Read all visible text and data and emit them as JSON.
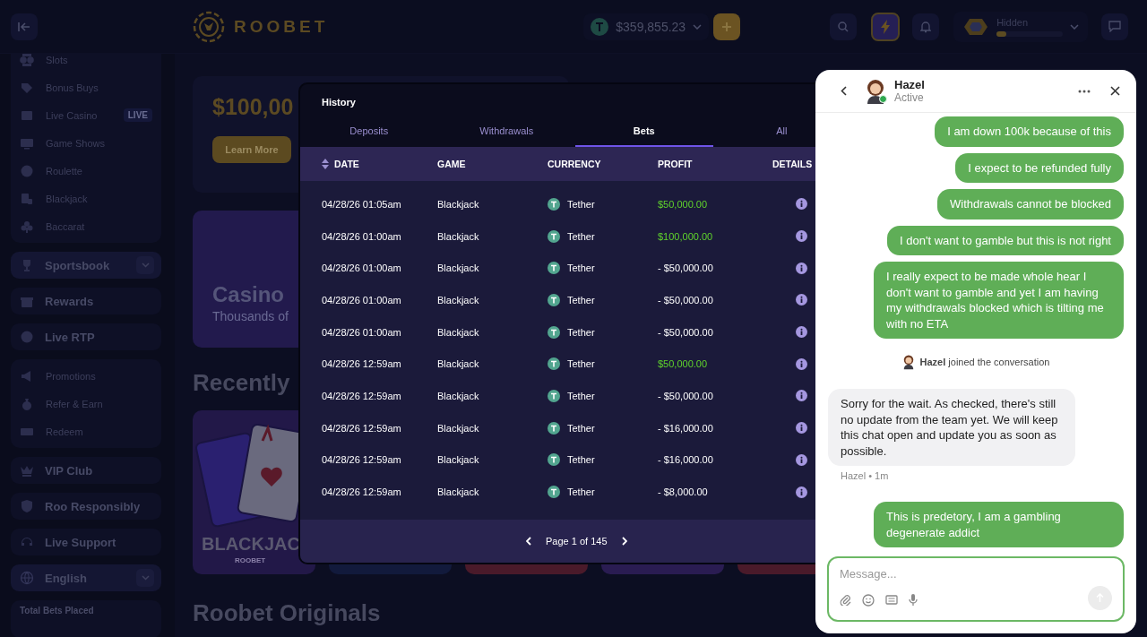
{
  "header": {
    "logo_text": "ROOBET",
    "balance": "$359,855.23",
    "profile": {
      "name": "Hidden",
      "level": 0.15
    }
  },
  "sidebar": {
    "sections": [
      {
        "kind": "group",
        "items": [
          {
            "label": "Slots"
          },
          {
            "label": "Bonus Buys"
          },
          {
            "label": "Live Casino",
            "badge": "LIVE"
          },
          {
            "label": "Game Shows"
          },
          {
            "label": "Roulette"
          },
          {
            "label": "Blackjack"
          },
          {
            "label": "Baccarat"
          }
        ]
      },
      {
        "kind": "single",
        "label": "Sportsbook",
        "dropdown": true
      },
      {
        "kind": "single",
        "label": "Rewards",
        "dropdown": false
      },
      {
        "kind": "single",
        "label": "Live RTP",
        "dropdown": false
      },
      {
        "kind": "group",
        "items": [
          {
            "label": "Promotions"
          },
          {
            "label": "Refer & Earn"
          },
          {
            "label": "Redeem"
          }
        ]
      },
      {
        "kind": "single",
        "label": "VIP Club",
        "dropdown": false
      },
      {
        "kind": "single",
        "label": "Roo Responsibly",
        "dropdown": false
      },
      {
        "kind": "single",
        "label": "Live Support",
        "dropdown": false
      },
      {
        "kind": "single",
        "label": "English",
        "dropdown": true
      }
    ],
    "footer": "Total Bets Placed"
  },
  "main": {
    "promo": {
      "amount": "$100,00",
      "button": "Learn More"
    },
    "casino_card": {
      "title": "Casino",
      "subtitle": "Thousands of"
    },
    "recent_heading": "Recently",
    "game_card": {
      "title": "BLACKJAC",
      "brand": "ROOBET"
    },
    "originals_heading": "Roobet Originals"
  },
  "history": {
    "title": "History",
    "tabs": [
      {
        "label": "Deposits",
        "selected": false
      },
      {
        "label": "Withdrawals",
        "selected": false
      },
      {
        "label": "Bets",
        "selected": true
      },
      {
        "label": "All",
        "selected": false
      }
    ],
    "columns": [
      "DATE",
      "GAME",
      "CURRENCY",
      "PROFIT",
      "DETAILS"
    ],
    "rows": [
      {
        "date": "04/28/26 01:05am",
        "game": "Blackjack",
        "currency": "Tether",
        "profit": "$50,000.00",
        "kind": "win"
      },
      {
        "date": "04/28/26 01:00am",
        "game": "Blackjack",
        "currency": "Tether",
        "profit": "$100,000.00",
        "kind": "win"
      },
      {
        "date": "04/28/26 01:00am",
        "game": "Blackjack",
        "currency": "Tether",
        "profit": "- $50,000.00",
        "kind": "loss"
      },
      {
        "date": "04/28/26 01:00am",
        "game": "Blackjack",
        "currency": "Tether",
        "profit": "- $50,000.00",
        "kind": "loss"
      },
      {
        "date": "04/28/26 01:00am",
        "game": "Blackjack",
        "currency": "Tether",
        "profit": "- $50,000.00",
        "kind": "loss"
      },
      {
        "date": "04/28/26 12:59am",
        "game": "Blackjack",
        "currency": "Tether",
        "profit": "$50,000.00",
        "kind": "win"
      },
      {
        "date": "04/28/26 12:59am",
        "game": "Blackjack",
        "currency": "Tether",
        "profit": "- $50,000.00",
        "kind": "loss"
      },
      {
        "date": "04/28/26 12:59am",
        "game": "Blackjack",
        "currency": "Tether",
        "profit": "- $16,000.00",
        "kind": "loss"
      },
      {
        "date": "04/28/26 12:59am",
        "game": "Blackjack",
        "currency": "Tether",
        "profit": "- $16,000.00",
        "kind": "loss"
      },
      {
        "date": "04/28/26 12:59am",
        "game": "Blackjack",
        "currency": "Tether",
        "profit": "- $8,000.00",
        "kind": "loss"
      }
    ],
    "pagination": "Page 1 of 145"
  },
  "chat": {
    "agent": {
      "name": "Hazel",
      "status": "Active",
      "online": true
    },
    "messages": [
      {
        "kind": "user",
        "text": "I am down 100k because of this"
      },
      {
        "kind": "user",
        "text": "I expect to be refunded fully"
      },
      {
        "kind": "user",
        "text": "Withdrawals cannot be blocked"
      },
      {
        "kind": "user",
        "text": "I don't want to gamble but this is not right"
      },
      {
        "kind": "user",
        "text": "I really expect to be made whole hear I don't want to gamble and yet I am having my withdrawals blocked which is tilting me with no ETA"
      },
      {
        "kind": "system",
        "text": "**Hazel** joined the conversation"
      },
      {
        "kind": "agent",
        "text": "Sorry for the wait. As checked, there's still no update from the team yet. We will keep this chat open and update you as soon as possible.",
        "meta": "Hazel • 1m"
      },
      {
        "kind": "user",
        "text": "This is predetory, I am a gambling degenerate addict"
      }
    ],
    "input": {
      "placeholder": "Message..."
    }
  }
}
